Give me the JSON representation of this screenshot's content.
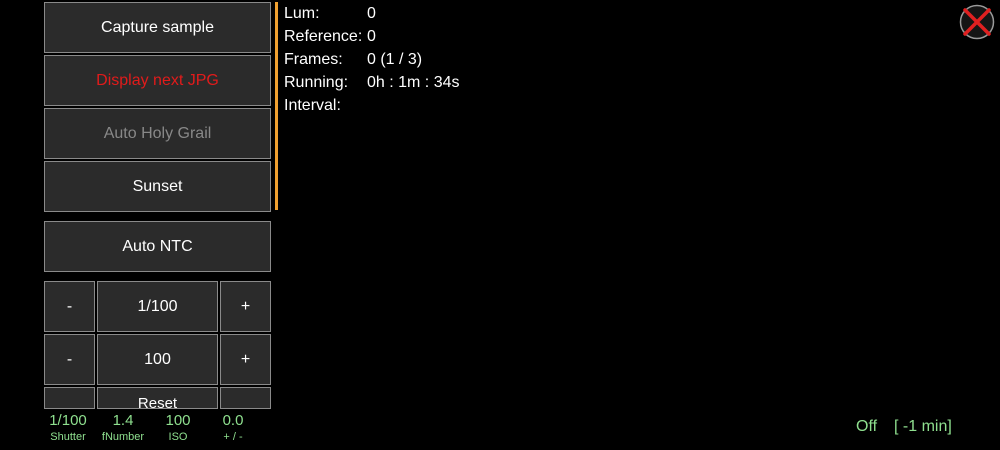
{
  "buttons": {
    "capture_sample": "Capture sample",
    "display_next_jpg": "Display next JPG",
    "auto_holy_grail": "Auto Holy Grail",
    "sunset": "Sunset",
    "auto_ntc": "Auto NTC",
    "minus": "-",
    "plus": "+",
    "shutter_value": "1/100",
    "iso_value": "100",
    "reset": "Reset"
  },
  "info": [
    {
      "label": "Lum:",
      "value": "0"
    },
    {
      "label": "Reference:",
      "value": "0"
    },
    {
      "label": "Frames:",
      "value": "0 (1 / 3)"
    },
    {
      "label": "Running:",
      "value": "0h : 1m : 34s"
    },
    {
      "label": "Interval:",
      "value": ""
    }
  ],
  "stats": [
    {
      "value": "1/100",
      "label": "Shutter"
    },
    {
      "value": "1.4",
      "label": "fNumber"
    },
    {
      "value": "100",
      "label": "ISO"
    },
    {
      "value": "0.0",
      "label": "+ / -"
    }
  ],
  "status": {
    "state": "Off",
    "offset": "[ -1 min]"
  },
  "colors": {
    "accent": "#f0a030",
    "warning_text": "#e11b1b",
    "status_green": "#8fe08f",
    "close_red": "#e02020"
  }
}
